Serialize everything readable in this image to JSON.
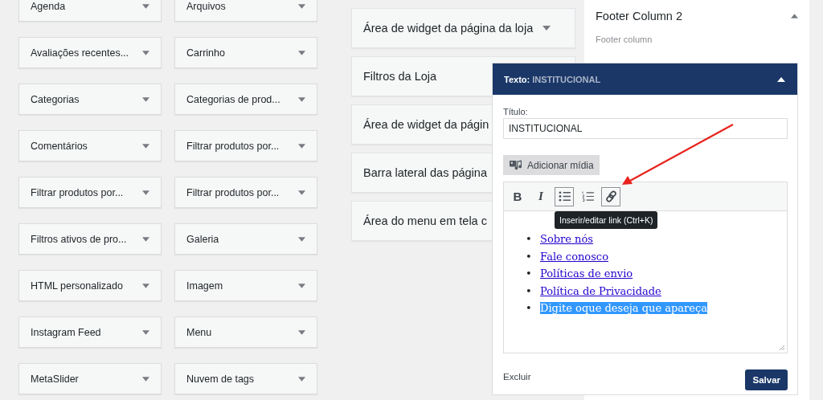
{
  "widgets": [
    {
      "name": "Agenda",
      "expanded": false
    },
    {
      "name": "Arquivos",
      "expanded": false
    },
    {
      "name": "Avaliações recentes...",
      "expanded": false
    },
    {
      "name": "Carrinho",
      "expanded": false
    },
    {
      "name": "Categorias",
      "expanded": false
    },
    {
      "name": "Categorias de prod...",
      "expanded": false
    },
    {
      "name": "Comentários",
      "expanded": false
    },
    {
      "name": "Filtrar produtos por...",
      "expanded": false
    },
    {
      "name": "Filtrar produtos por...",
      "expanded": false
    },
    {
      "name": "Filtrar produtos por...",
      "expanded": false
    },
    {
      "name": "Filtros ativos de pro...",
      "expanded": false
    },
    {
      "name": "Galeria",
      "expanded": false
    },
    {
      "name": "HTML personalizado",
      "expanded": false
    },
    {
      "name": "Imagem",
      "expanded": false
    },
    {
      "name": "Instagram Feed",
      "expanded": false
    },
    {
      "name": "Menu",
      "expanded": false
    },
    {
      "name": "MetaSlider",
      "expanded": false
    },
    {
      "name": "Nuvem de tags",
      "expanded": false
    }
  ],
  "open_area": {
    "title": "Área de widget da página da loja",
    "expanded": false
  },
  "widget_areas": [
    {
      "title": "Filtros da Loja"
    },
    {
      "title": "Área de widget da págin"
    },
    {
      "title": "Barra lateral das página"
    },
    {
      "title": "Área do menu em tela c"
    }
  ],
  "footer_column": {
    "title": "Footer Column 2",
    "description": "Footer column",
    "expanded": true
  },
  "text_widget": {
    "label": "Texto:",
    "name": "INSTITUCIONAL",
    "expanded": true,
    "title_label": "Título:",
    "title_value": "INSTITUCIONAL",
    "add_media": "Adicionar mídia",
    "toolbar": [
      {
        "kind": "bold",
        "label": "B",
        "active": false
      },
      {
        "kind": "italic",
        "label": "I",
        "active": false
      },
      {
        "kind": "bullet-list",
        "active": true
      },
      {
        "kind": "numbered-list",
        "active": false
      },
      {
        "kind": "link",
        "active": true
      }
    ],
    "tooltip": "Inserir/editar link (Ctrl+K)",
    "list_items": [
      {
        "bullet": "•",
        "text": "Sobre nós",
        "link": true,
        "selected": false
      },
      {
        "bullet": "•",
        "text": "Fale conosco",
        "link": true,
        "selected": false
      },
      {
        "bullet": "•",
        "text": "Políticas de envio",
        "link": true,
        "selected": false
      },
      {
        "bullet": "•",
        "text": "Política de Privacidade",
        "link": true,
        "selected": false
      },
      {
        "bullet": "•",
        "text": "Digite oque deseja que apareça",
        "link": false,
        "selected": true
      }
    ],
    "delete": "Excluir",
    "save": "Salvar"
  }
}
